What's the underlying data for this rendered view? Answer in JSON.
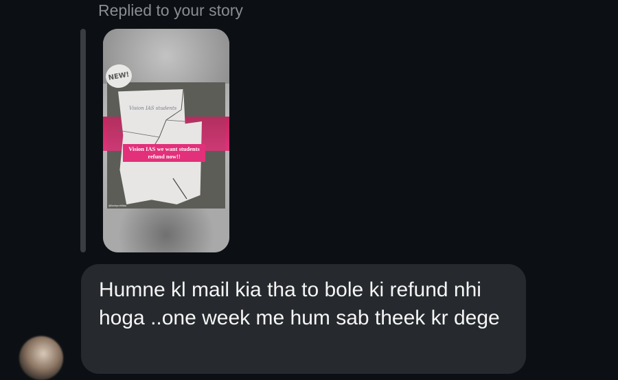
{
  "reply": {
    "caption": "Replied to your story"
  },
  "story": {
    "sticker_text": "NEW!",
    "overlay_text": "Vision IAS we want students refund now!!",
    "handwriting": "Vision IAS students",
    "watermark": "@luckyrohillas"
  },
  "message": {
    "text": "Humne kl mail kia tha to bole ki refund nhi hoga ..one week me hum sab theek kr dege"
  },
  "colors": {
    "background": "#0c1014",
    "bubble": "#262a2e",
    "caption": "#8a8d91",
    "accent_pink": "#e2307a"
  }
}
